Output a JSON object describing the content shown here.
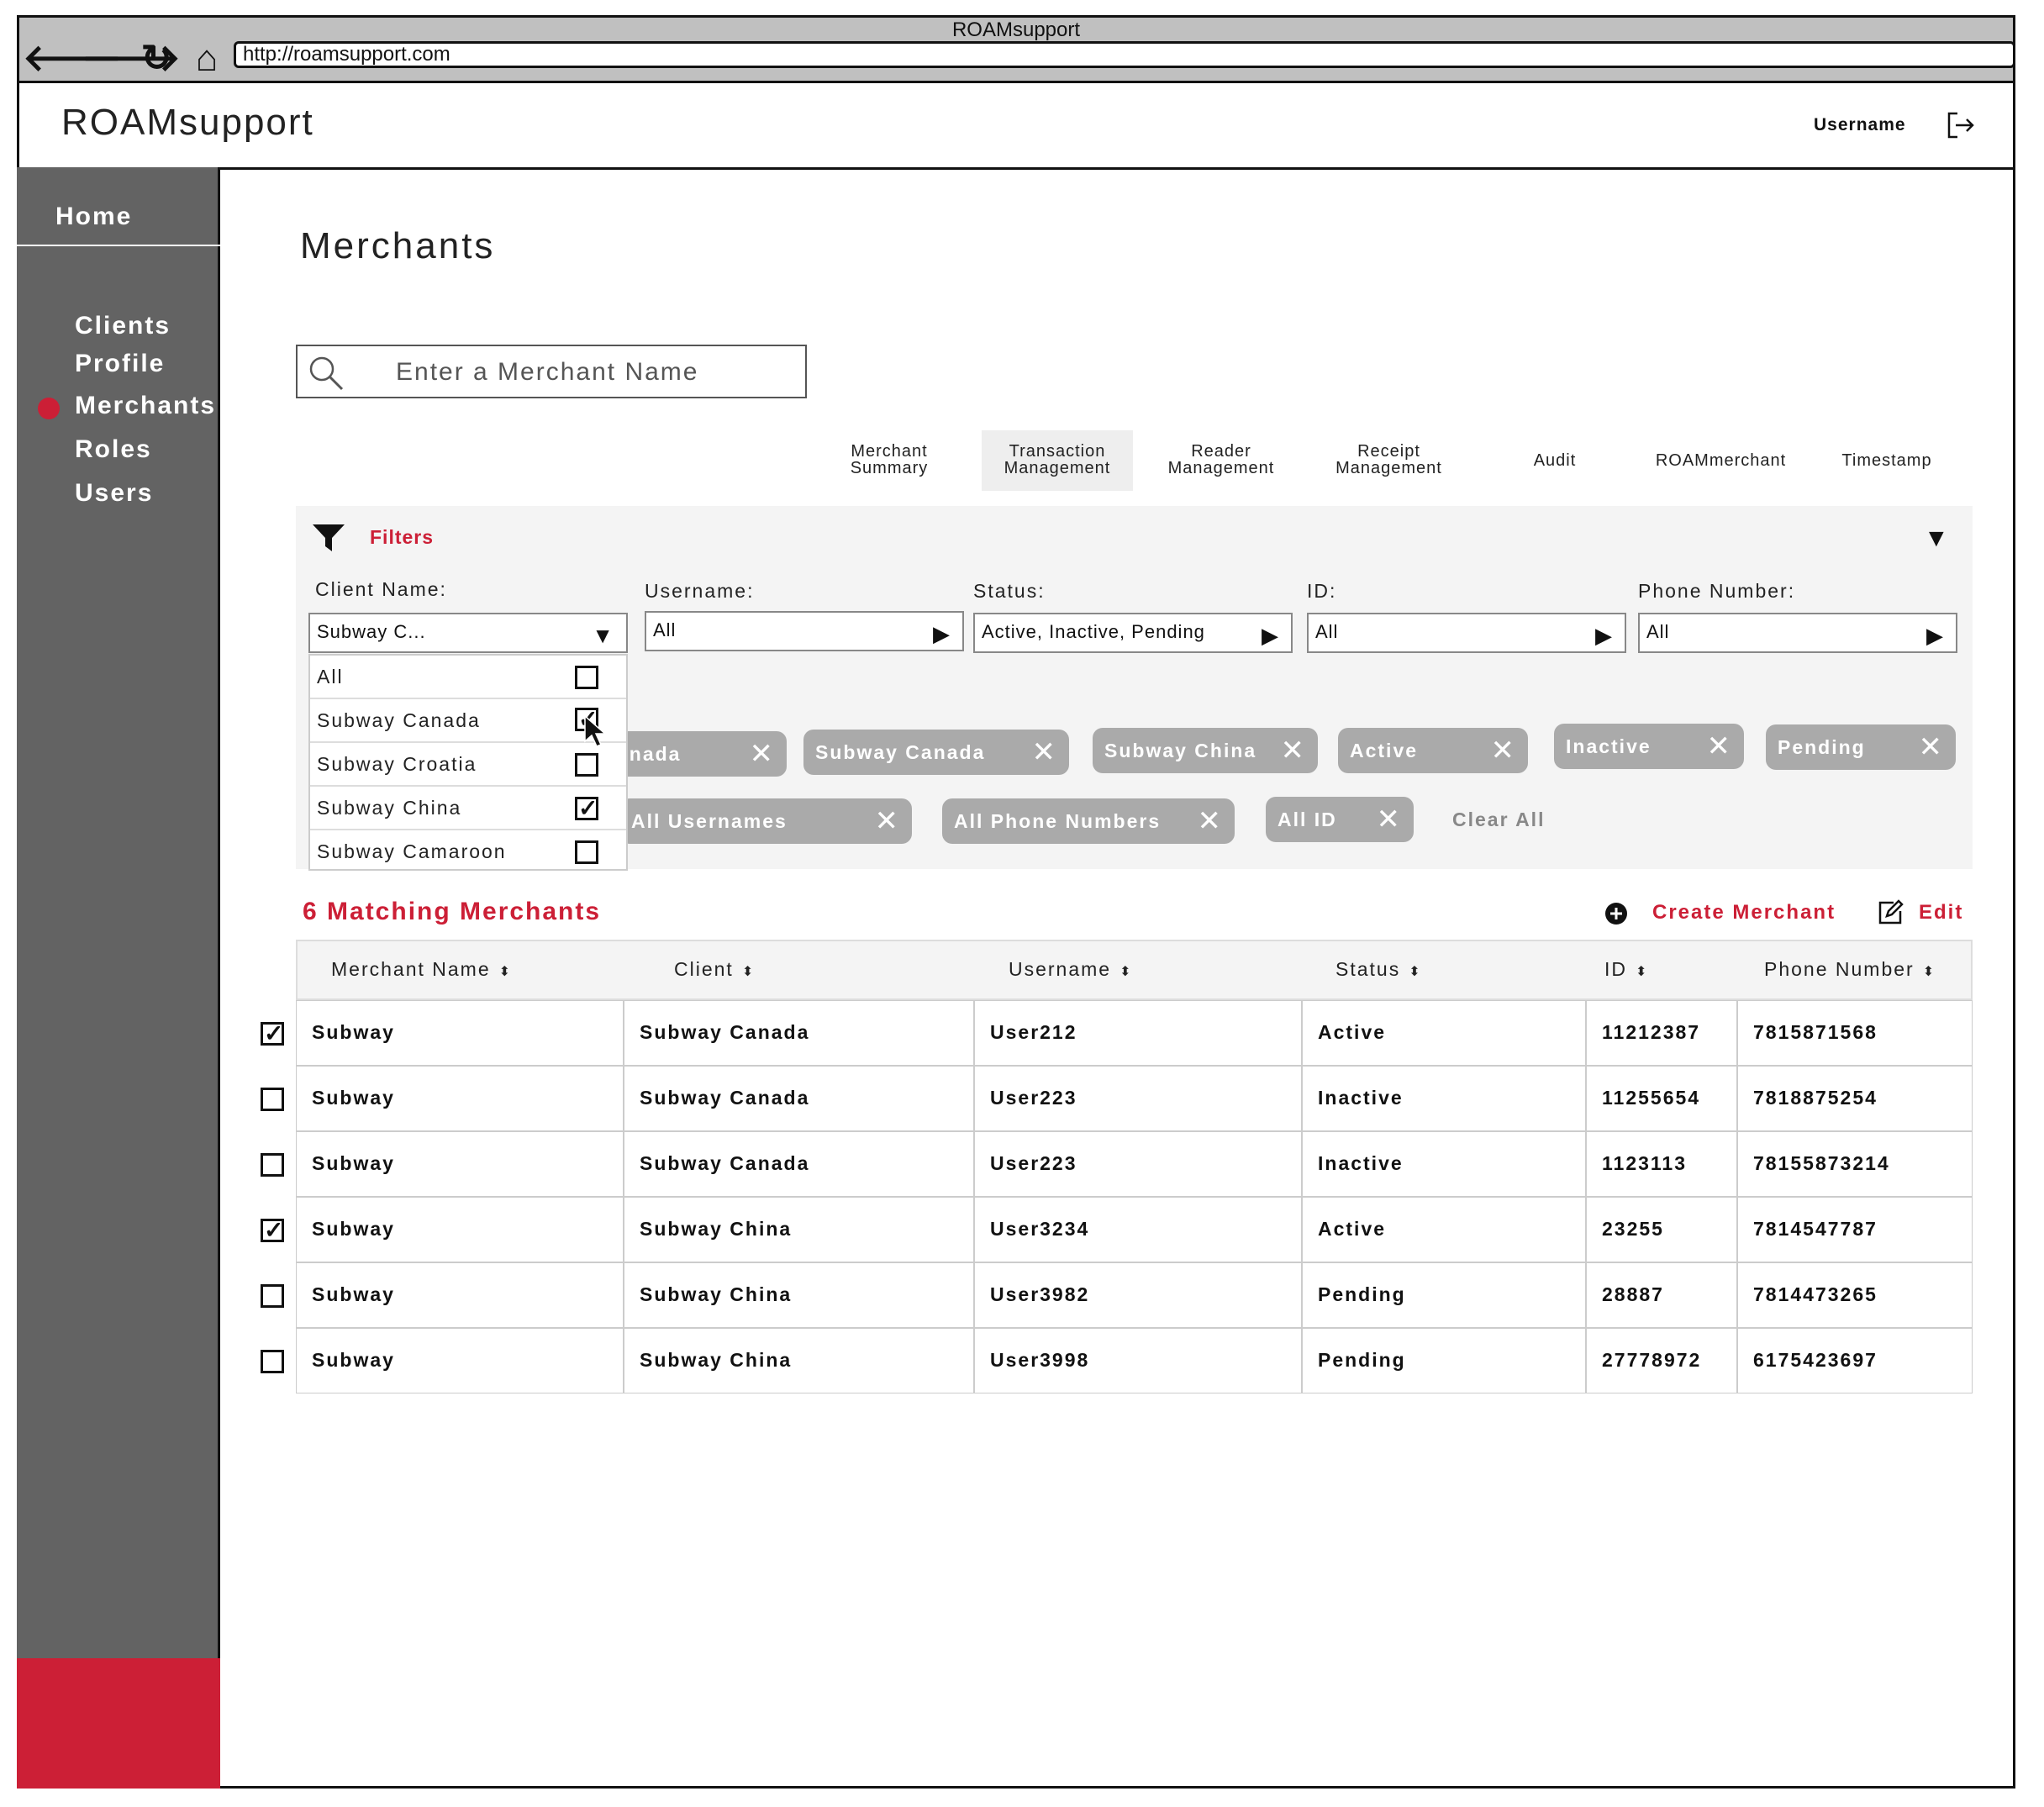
{
  "browser": {
    "window_title": "ROAMsupport",
    "url": "http://roamsupport.com"
  },
  "header": {
    "app_title": "ROAMsupport",
    "username": "Username"
  },
  "sidebar": {
    "home": "Home",
    "items": [
      {
        "label": "Clients"
      },
      {
        "label": "Profile"
      },
      {
        "label": "Merchants",
        "active": true
      },
      {
        "label": "Roles"
      },
      {
        "label": "Users"
      }
    ]
  },
  "main": {
    "page_title": "Merchants",
    "search": {
      "placeholder": "Enter a Merchant Name"
    },
    "tabs": [
      {
        "line1": "Merchant",
        "line2": "Summary"
      },
      {
        "line1": "Transaction",
        "line2": "Management",
        "active": true
      },
      {
        "line1": "Reader",
        "line2": "Management"
      },
      {
        "line1": "Receipt",
        "line2": "Management"
      },
      {
        "line1": "Audit",
        "line2": ""
      },
      {
        "line1": "ROAMmerchant",
        "line2": ""
      },
      {
        "line1": "Timestamp",
        "line2": ""
      }
    ]
  },
  "filters": {
    "title": "Filters",
    "client_name": {
      "label": "Client Name:",
      "value": "Subway C..."
    },
    "username": {
      "label": "Username:",
      "value": "All"
    },
    "status": {
      "label": "Status:",
      "value": "Active, Inactive, Pending"
    },
    "id": {
      "label": "ID:",
      "value": "All"
    },
    "phone": {
      "label": "Phone Number:",
      "value": "All"
    },
    "dropdown_options": [
      {
        "label": "All",
        "checked": false
      },
      {
        "label": "Subway Canada",
        "checked": true
      },
      {
        "label": "Subway Croatia",
        "checked": false
      },
      {
        "label": "Subway China",
        "checked": true
      },
      {
        "label": "Subway Camaroon",
        "checked": false
      }
    ],
    "chips": [
      "anada",
      "Subway Canada",
      "Subway China",
      "Active",
      "Inactive",
      "Pending",
      "All Usernames",
      "All Phone Numbers",
      "All ID"
    ],
    "clear_all": "Clear All"
  },
  "results": {
    "count_label": "6 Matching Merchants",
    "create_label": "Create Merchant",
    "edit_label": "Edit"
  },
  "table": {
    "headers": [
      "Merchant Name",
      "Client",
      "Username",
      "Status",
      "ID",
      "Phone Number"
    ],
    "rows": [
      {
        "checked": true,
        "cells": [
          "Subway",
          "Subway Canada",
          "User212",
          "Active",
          "11212387",
          "7815871568"
        ]
      },
      {
        "checked": false,
        "cells": [
          "Subway",
          "Subway Canada",
          "User223",
          "Inactive",
          "11255654",
          "7818875254"
        ]
      },
      {
        "checked": false,
        "cells": [
          "Subway",
          "Subway Canada",
          "User223",
          "Inactive",
          "1123113",
          "78155873214"
        ]
      },
      {
        "checked": true,
        "cells": [
          "Subway",
          "Subway China",
          "User3234",
          "Active",
          "23255",
          "7814547787"
        ]
      },
      {
        "checked": false,
        "cells": [
          "Subway",
          "Subway China",
          "User3982",
          "Pending",
          "28887",
          "7814473265"
        ]
      },
      {
        "checked": false,
        "cells": [
          "Subway",
          "Subway China",
          "User3998",
          "Pending",
          "27778972",
          "6175423697"
        ]
      }
    ]
  },
  "colors": {
    "accent": "#cc1f36",
    "sidebar": "#636363",
    "chip": "#aaaaaa"
  }
}
